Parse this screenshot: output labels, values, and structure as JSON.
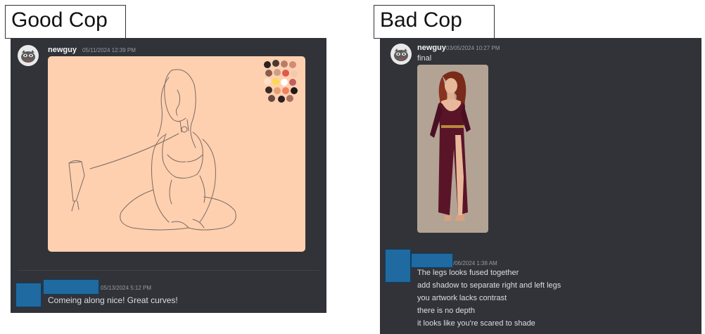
{
  "left": {
    "heading": "Good Cop",
    "post": {
      "username": "newguy",
      "timestamp": "05/11/2024 12:39 PM"
    },
    "reply": {
      "timestamp": "05/13/2024 5:12 PM",
      "text": "Comeing along nice! Great curves!"
    }
  },
  "right": {
    "heading": "Bad Cop",
    "post": {
      "username": "newguy",
      "timestamp": "03/05/2024 10:27 PM",
      "text": "final"
    },
    "reply": {
      "timestamp": "/06/2024 1:38 AM",
      "lines": [
        "The legs looks fused together",
        "add shadow to separate right and left legs",
        "you artwork lacks contrast",
        "there is no depth",
        "it looks like you're scared to shade"
      ]
    }
  },
  "colors": {
    "panel": "#313338",
    "redaction": "#1f6aa0",
    "sketch_bg": "#ffd0b0",
    "render_bg": "#b3a395"
  }
}
